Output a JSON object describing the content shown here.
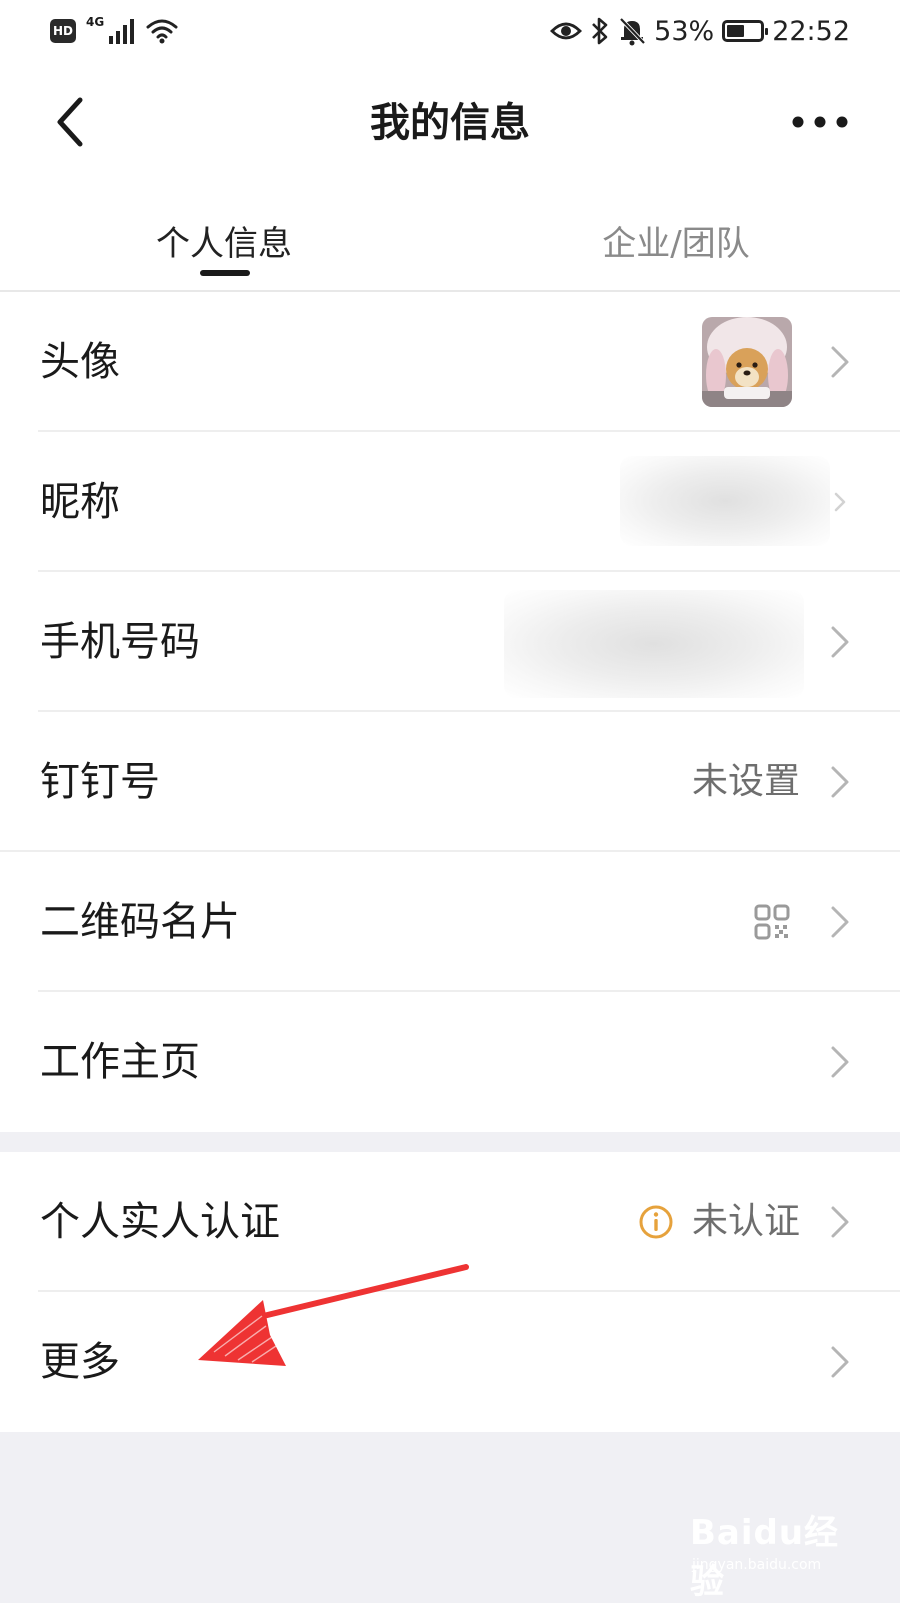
{
  "status_bar": {
    "hd_badge": "HD",
    "network": "4G",
    "battery_percent": "53%",
    "battery_level": 0.53,
    "time": "22:52",
    "icons": [
      "hd-icon",
      "signal-icon",
      "wifi-icon",
      "eye-icon",
      "bluetooth-icon",
      "bell-off-icon",
      "battery-icon"
    ]
  },
  "header": {
    "title": "我的信息",
    "back_icon": "chevron-left-icon",
    "more_icon": "more-dots-icon"
  },
  "tabs": [
    {
      "label": "个人信息",
      "active": true
    },
    {
      "label": "企业/团队",
      "active": false
    }
  ],
  "profile_section": {
    "rows": [
      {
        "label": "头像",
        "value": "",
        "accessory": "avatar-image"
      },
      {
        "label": "昵称",
        "value": "",
        "accessory": "blurred-value"
      },
      {
        "label": "手机号码",
        "value": "",
        "accessory": "blurred-value"
      },
      {
        "label": "钉钉号",
        "value": "未设置",
        "accessory": ""
      },
      {
        "label": "二维码名片",
        "value": "",
        "accessory": "qr-code-icon"
      },
      {
        "label": "工作主页",
        "value": "",
        "accessory": ""
      }
    ]
  },
  "verify_section": {
    "rows": [
      {
        "label": "个人实人认证",
        "value": "未认证",
        "accessory": "info-icon"
      },
      {
        "label": "更多",
        "value": "",
        "accessory": ""
      }
    ]
  },
  "watermark": {
    "brand": "Baidu经验",
    "url": "jingyan.baidu.com"
  },
  "colors": {
    "background": "#f0f0f4",
    "surface": "#ffffff",
    "text_primary": "#1a1a1a",
    "text_secondary": "#6e6e6e",
    "tab_inactive": "#8a8a8a",
    "warning_icon": "#e6a23c",
    "annotation_arrow": "#ee3333"
  }
}
